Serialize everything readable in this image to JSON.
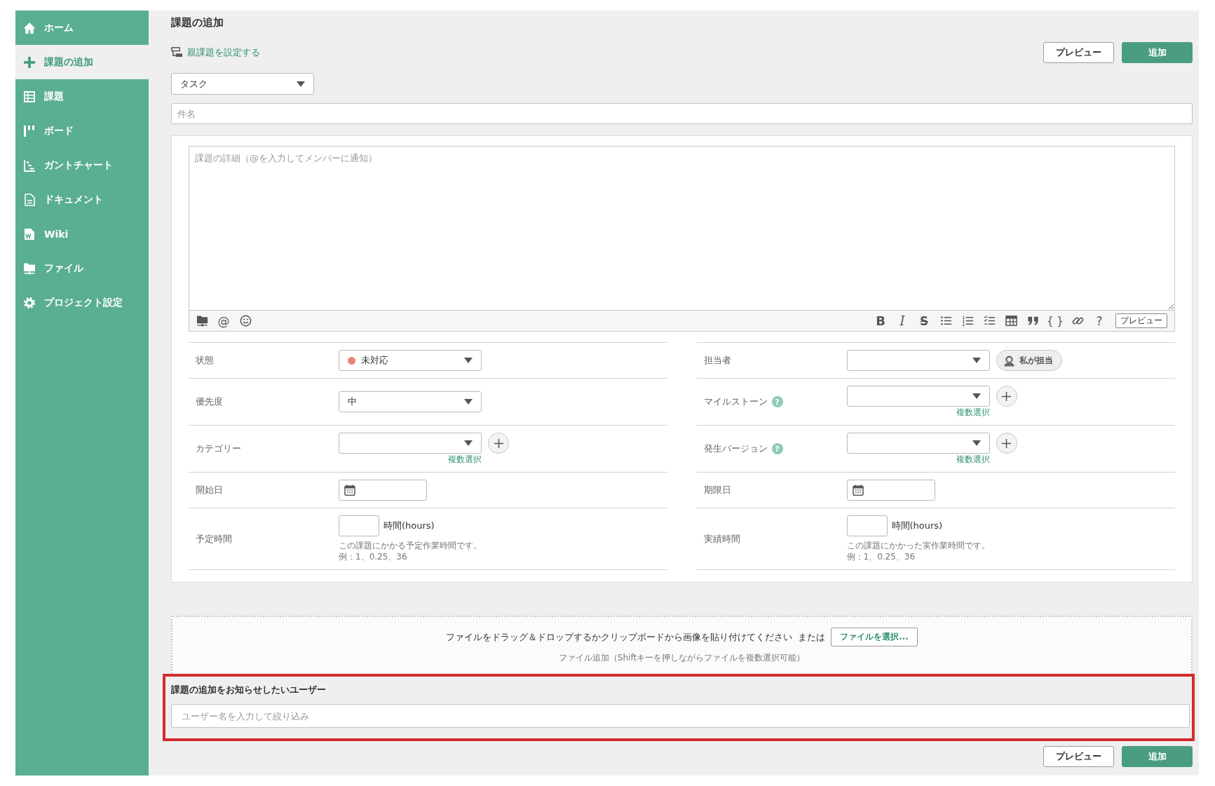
{
  "sidebar": {
    "items": [
      {
        "label": "ホーム",
        "selected": false
      },
      {
        "label": "課題の追加",
        "selected": true
      },
      {
        "label": "課題",
        "selected": false
      },
      {
        "label": "ボード",
        "selected": false
      },
      {
        "label": "ガントチャート",
        "selected": false
      },
      {
        "label": "ドキュメント",
        "selected": false
      },
      {
        "label": "Wiki",
        "selected": false
      },
      {
        "label": "ファイル",
        "selected": false
      },
      {
        "label": "プロジェクト設定",
        "selected": false
      }
    ]
  },
  "page": {
    "title": "課題の追加"
  },
  "parent_issue_link": {
    "label": "親課題を設定する"
  },
  "top_actions": [
    {
      "kind": "secondary",
      "label": "プレビュー"
    },
    {
      "kind": "primary",
      "label": "追加"
    }
  ],
  "issue_type": {
    "value": "タスク"
  },
  "subject": {
    "placeholder": "件名"
  },
  "description": {
    "placeholder": "課題の詳細（@を入力してメンバーに通知）"
  },
  "editor_toolbar": {
    "left": [
      {
        "kind": "attach"
      },
      {
        "kind": "mention",
        "label": "@"
      },
      {
        "kind": "emoji"
      }
    ],
    "right": [
      {
        "kind": "bold",
        "label": "B"
      },
      {
        "kind": "italic",
        "label": "I"
      },
      {
        "kind": "strike",
        "label": "S"
      },
      {
        "kind": "bullets"
      },
      {
        "kind": "numbers"
      },
      {
        "kind": "checklist"
      },
      {
        "kind": "table"
      },
      {
        "kind": "quote"
      },
      {
        "kind": "code",
        "label": "{ }"
      },
      {
        "kind": "link"
      },
      {
        "kind": "help",
        "label": "?"
      },
      {
        "kind": "preview",
        "label": "プレビュー"
      }
    ]
  },
  "fields": [
    {
      "label": "状態",
      "kind": "select",
      "value": "未対応",
      "color": "#e8837a"
    },
    {
      "label": "担当者",
      "kind": "select",
      "assign_button": "私が担当"
    },
    {
      "label": "優先度",
      "kind": "select",
      "value": "中"
    },
    {
      "label": "マイルストーン",
      "kind": "select",
      "help": "?",
      "add_button": true,
      "multi_select": "複数選択"
    },
    {
      "label": "カテゴリー",
      "kind": "select",
      "add_button": true,
      "multi_select": "複数選択"
    },
    {
      "label": "発生バージョン",
      "kind": "select",
      "help": "?",
      "add_button": true,
      "multi_select": "複数選択"
    },
    {
      "label": "開始日",
      "kind": "date"
    },
    {
      "label": "期限日",
      "kind": "date"
    },
    {
      "label": "予定時間",
      "kind": "hours",
      "unit": "時間(hours)",
      "notes": [
        "この課題にかかる予定作業時間です。",
        "例：1、0.25、36"
      ]
    },
    {
      "label": "実績時間",
      "kind": "hours",
      "unit": "時間(hours)",
      "notes": [
        "この課題にかかった実作業時間です。",
        "例：1、0.25、36"
      ]
    }
  ],
  "attachments": {
    "instruction": "ファイルをドラッグ＆ドロップするかクリップボードから画像を貼り付けてください",
    "or_label": "または",
    "button": "ファイルを選択...",
    "hint": "ファイル追加（Shiftキーを押しながらファイルを複数選択可能）"
  },
  "notify": {
    "highlighted": true,
    "label": "課題の追加をお知らせしたいユーザー",
    "placeholder": "ユーザー名を入力して絞り込み"
  },
  "bottom_actions": [
    {
      "kind": "secondary",
      "label": "プレビュー"
    },
    {
      "kind": "primary",
      "label": "追加"
    }
  ]
}
